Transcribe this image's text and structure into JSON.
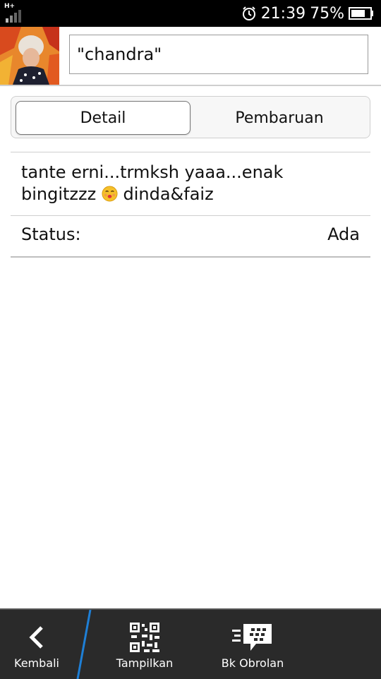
{
  "status_bar": {
    "network_label": "H+",
    "time": "21:39",
    "battery_percent": "75%",
    "battery_level": 0.75,
    "icons": [
      "signal-icon",
      "alarm-icon",
      "battery-icon"
    ]
  },
  "contact": {
    "name": "\"chandra\""
  },
  "tabs": [
    {
      "label": "Detail",
      "active": true
    },
    {
      "label": "Pembaruan",
      "active": false
    }
  ],
  "detail": {
    "message_text": "tante erni...trmksh yaaa...enak bingitzzz",
    "message_suffix": " dinda&faiz",
    "status_label": "Status:",
    "status_value": "Ada"
  },
  "bottom_bar": {
    "back_label": "Kembali",
    "show_label": "Tampilkan",
    "chat_label": "Bk Obrolan"
  },
  "colors": {
    "status_bar_bg": "#000000",
    "bottom_bar_bg": "#2a2a2a",
    "divider_accent": "#1e7fd6"
  }
}
